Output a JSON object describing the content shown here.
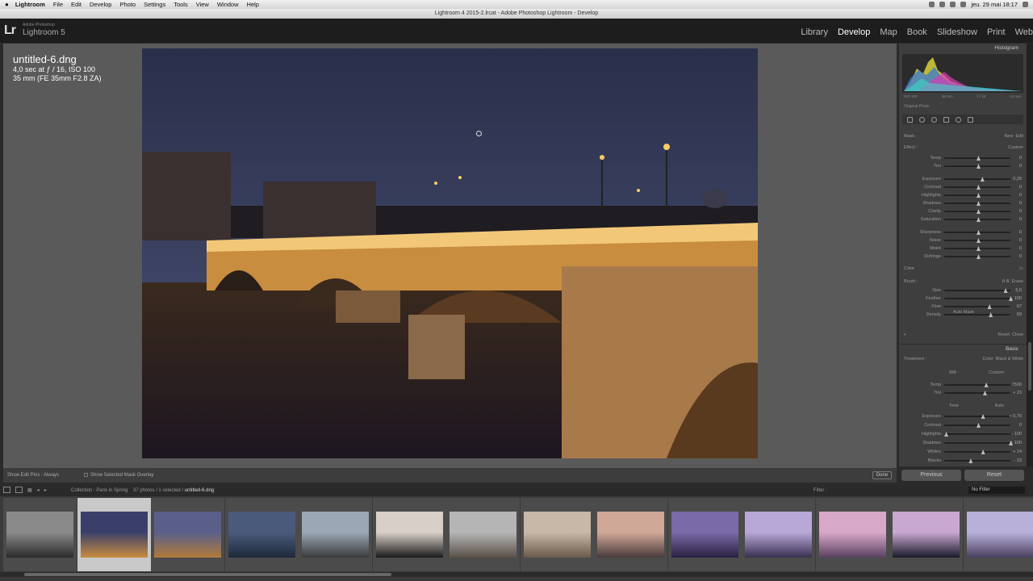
{
  "macmenu": {
    "app": "Lightroom",
    "items": [
      "File",
      "Edit",
      "Develop",
      "Photo",
      "Settings",
      "Tools",
      "View",
      "Window",
      "Help"
    ],
    "clock": "jeu. 29 mai 18:17"
  },
  "window": {
    "title": "Lightroom 4 2015-2.lrcat - Adobe Photoshop Lightroom - Develop"
  },
  "app": {
    "logo": "Lr",
    "logo_sub": "Adobe Photoshop",
    "name": "Lightroom 5"
  },
  "modules": [
    "Library",
    "Develop",
    "Map",
    "Book",
    "Slideshow",
    "Print",
    "Web"
  ],
  "active_module": "Develop",
  "photo_info": {
    "filename": "untitled-6.dng",
    "line1": "4,0 sec at ƒ / 16, ISO 100",
    "line2": "35 mm (FE 35mm F2.8 ZA)"
  },
  "toolbar": {
    "show_edit_pins": "Show Edit Pins :",
    "edit_pins_value": "Always",
    "overlay": "Show Selected Mask Overlay",
    "done": "Done"
  },
  "histogram": {
    "title": "Histogram",
    "iso": "ISO 100",
    "focal": "35 mm",
    "aperture": "f / 16",
    "shutter": "4,0 sec",
    "original": "Original Photo"
  },
  "mask": {
    "label": "Mask :",
    "new": "New",
    "edit": "Edit",
    "effect": "Effect :",
    "effect_value": "Custom"
  },
  "mask_sliders": [
    {
      "label": "Temp",
      "value": "0",
      "pct": 0.5
    },
    {
      "label": "Tint",
      "value": "0",
      "pct": 0.5
    },
    {
      "label": "Exposure",
      "value": "0,29",
      "pct": 0.56
    },
    {
      "label": "Contrast",
      "value": "0",
      "pct": 0.5
    },
    {
      "label": "Highlights",
      "value": "0",
      "pct": 0.5
    },
    {
      "label": "Shadows",
      "value": "0",
      "pct": 0.5
    },
    {
      "label": "Clarity",
      "value": "0",
      "pct": 0.5
    },
    {
      "label": "Saturation",
      "value": "0",
      "pct": 0.5
    },
    {
      "label": "Sharpness",
      "value": "0",
      "pct": 0.5
    },
    {
      "label": "Noise",
      "value": "0",
      "pct": 0.5
    },
    {
      "label": "Moiré",
      "value": "0",
      "pct": 0.5
    },
    {
      "label": "Defringe",
      "value": "0",
      "pct": 0.5
    }
  ],
  "color_label": "Color",
  "brush": {
    "label": "Brush :",
    "a": "A",
    "b": "B",
    "erase": "Erase",
    "auto_mask": "Auto Mask",
    "reset": "Reset",
    "close": "Close"
  },
  "brush_sliders": [
    {
      "label": "Size",
      "value": "5,0",
      "pct": 0.92
    },
    {
      "label": "Feather",
      "value": "100",
      "pct": 1.0
    },
    {
      "label": "Flow",
      "value": "67",
      "pct": 0.67
    },
    {
      "label": "Density",
      "value": "69",
      "pct": 0.69
    }
  ],
  "basic": {
    "title": "Basic",
    "treatment": "Treatment :",
    "color": "Color",
    "bw": "Black & White",
    "wb": "WB :",
    "wb_value": "Custom",
    "tone": "Tone",
    "auto": "Auto"
  },
  "wb_sliders": [
    {
      "label": "Temp",
      "value": "7500",
      "pct": 0.62
    },
    {
      "label": "Tint",
      "value": "+ 23",
      "pct": 0.6
    }
  ],
  "tone_sliders": [
    {
      "label": "Exposure",
      "value": "+ 0,70",
      "pct": 0.57
    },
    {
      "label": "Contrast",
      "value": "0",
      "pct": 0.5
    },
    {
      "label": "Highlights",
      "value": "- 100",
      "pct": 0.0
    },
    {
      "label": "Shadows",
      "value": "+ 100",
      "pct": 1.0
    },
    {
      "label": "Whites",
      "value": "+ 14",
      "pct": 0.57
    },
    {
      "label": "Blacks",
      "value": "- 23",
      "pct": 0.38
    }
  ],
  "buttons": {
    "previous": "Previous",
    "reset": "Reset"
  },
  "filmstrip_bar": {
    "collection": "Collection : Paris in Spring",
    "count": "37 photos / 1 selected /",
    "current": "untitled-6.dng",
    "filter": "Filter :",
    "no_filter": "No Filter"
  },
  "filmstrip_count": 14,
  "filmstrip_selected": 1,
  "colors": {
    "accent": "#ffffff",
    "panel": "#3e3e3e",
    "bg": "#5a5a5a"
  }
}
